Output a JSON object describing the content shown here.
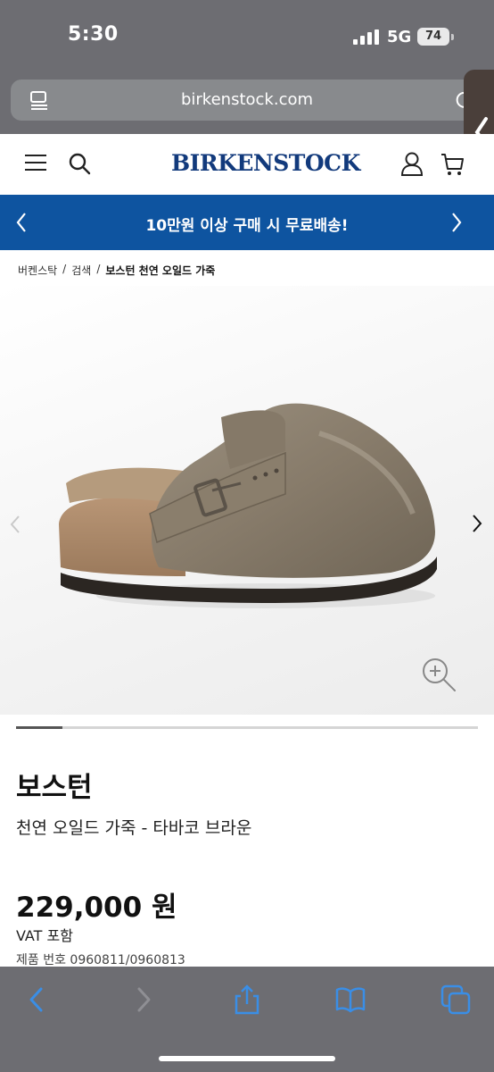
{
  "status_bar": {
    "time": "5:30",
    "network": "5G",
    "battery": "74"
  },
  "browser": {
    "url": "birkenstock.com"
  },
  "header": {
    "brand": "BIRKENSTOCK"
  },
  "promo": {
    "text": "10만원 이상 구매 시 무료배송!"
  },
  "breadcrumb": {
    "items": [
      "버켄스탁",
      "검색"
    ],
    "separator": "/",
    "current": "보스턴 천연 오일드 가죽"
  },
  "gallery": {
    "slide_progress": 0.1
  },
  "product": {
    "name": "보스턴",
    "subtitle": "천연 오일드 가죽 - 타바코 브라운",
    "price": "229,000 원",
    "vat": "VAT 포함",
    "number": "제품 번호 0960811/0960813"
  },
  "colors": {
    "brand_blue": "#123a7c",
    "promo_blue": "#0e54a0",
    "ios_tint": "#3a8ee6"
  },
  "icons": [
    "menu-icon",
    "search-icon",
    "account-icon",
    "cart-icon",
    "zoom-in-icon",
    "share-icon",
    "bookmarks-icon",
    "tabs-icon"
  ]
}
